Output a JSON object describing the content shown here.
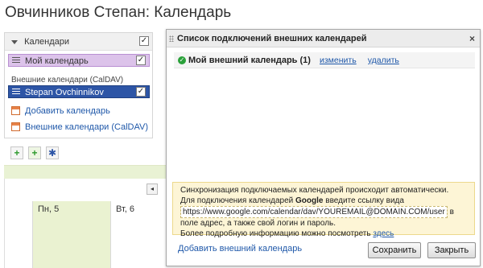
{
  "page": {
    "title": "Овчинников Степан: Календарь"
  },
  "sidebar": {
    "header_label": "Календари",
    "my_calendar": "Мой календарь",
    "external_header": "Внешние календари (CalDAV)",
    "external_calendar": "Stepan Ovchinnikov",
    "add_calendar_link": "Добавить календарь",
    "external_calendars_link": "Внешние календари (CalDAV)",
    "checkmark": "✓"
  },
  "toolbar": {
    "add_icon": "+",
    "settings_icon": "✱"
  },
  "grid": {
    "nav_left": "◂",
    "day_mon": "Пн, 5",
    "day_tue": "Вт, 6"
  },
  "dialog": {
    "title": "Список подключений внешних календарей",
    "close_glyph": "×",
    "item": {
      "name": "Мой внешний календарь (1)",
      "edit_link": "изменить",
      "delete_link": "удалить"
    },
    "info": {
      "line1": "Синхронизация подключаемых календарей происходит автоматически.",
      "line2_before": "Для подключения календарей ",
      "line2_bold": "Google",
      "line2_after": " введите ссылку вида",
      "url": "https://www.google.com/calendar/dav/YOUREMAIL@DOMAIN.COM/user",
      "line3_suffix": " в",
      "line4": "поле адрес, а также свой логин и пароль.",
      "line5_before": "Более подробную информацию можно посмотреть ",
      "line5_link": "здесь"
    },
    "add_external_link": "Добавить внешний календарь",
    "save_button": "Сохранить",
    "close_button": "Закрыть"
  },
  "colors": {
    "my_calendar_bg": "#dcc3ea",
    "external_calendar_bg": "#2d55a6",
    "link": "#1f58a9",
    "info_bg": "#fdf5d6",
    "today_bg": "#eaf2d1"
  }
}
